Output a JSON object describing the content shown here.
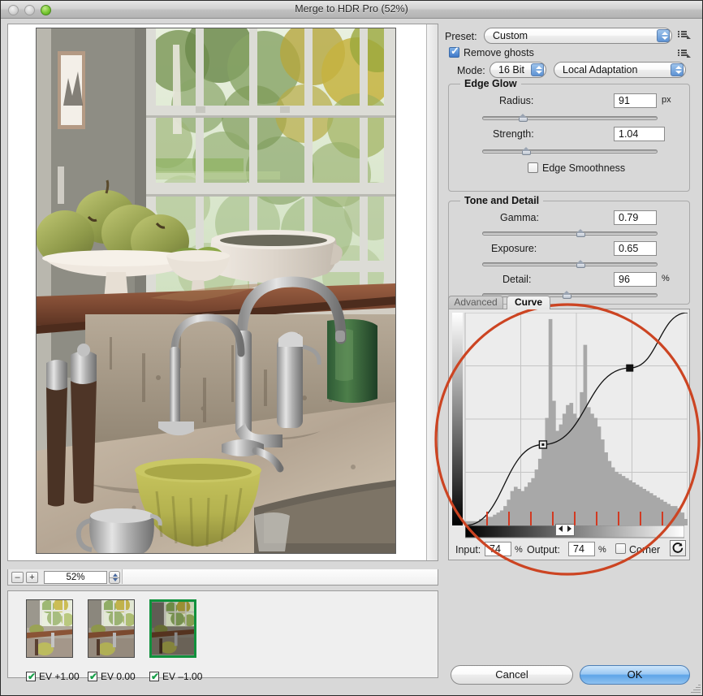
{
  "window": {
    "title": "Merge to HDR Pro (52%)",
    "traffic_lights": [
      "close",
      "minimize",
      "zoom"
    ]
  },
  "preview": {
    "zoom_value": "52%",
    "zoom_out_label": "–",
    "zoom_in_label": "+",
    "image_alt": "Kitchen counter with pears on a cake stand, white bowl, window with trees outside, faucet and green mixing bowl"
  },
  "thumbnails": [
    {
      "label": "EV +1.00",
      "checked": true,
      "selected": false
    },
    {
      "label": "EV 0.00",
      "checked": true,
      "selected": false
    },
    {
      "label": "EV –1.00",
      "checked": true,
      "selected": true
    }
  ],
  "settings": {
    "preset_label": "Preset:",
    "preset_value": "Custom",
    "remove_ghosts_label": "Remove ghosts",
    "remove_ghosts_checked": true,
    "mode_label": "Mode:",
    "bit_depth_value": "16 Bit",
    "method_value": "Local Adaptation",
    "edge_glow": {
      "title": "Edge Glow",
      "radius_label": "Radius:",
      "radius_value": "91",
      "radius_unit": "px",
      "radius_pct": 23,
      "strength_label": "Strength:",
      "strength_value": "1.04",
      "strength_pct": 25,
      "edge_smoothness_label": "Edge Smoothness",
      "edge_smoothness_checked": false
    },
    "tone_and_detail": {
      "title": "Tone and Detail",
      "gamma_label": "Gamma:",
      "gamma_value": "0.79",
      "gamma_pct": 56,
      "exposure_label": "Exposure:",
      "exposure_value": "0.65",
      "exposure_pct": 56,
      "detail_label": "Detail:",
      "detail_value": "96",
      "detail_unit": "%",
      "detail_pct": 48
    }
  },
  "curve_panel": {
    "tabs": [
      {
        "label": "Advanced",
        "active": false
      },
      {
        "label": "Curve",
        "active": true
      }
    ],
    "input_label": "Input:",
    "input_value": "74",
    "input_unit": "%",
    "output_label": "Output:",
    "output_value": "74",
    "output_unit": "%",
    "corner_label": "Corner",
    "corner_checked": false,
    "reset_icon": "reset-circular-arrow-icon",
    "annotation_color": "#cc4422"
  },
  "buttons": {
    "cancel_label": "Cancel",
    "ok_label": "OK"
  },
  "chart_data": {
    "type": "line",
    "title": "Tone Curve with Luminosity Histogram",
    "xlabel": "Input",
    "ylabel": "Output",
    "xlim": [
      0,
      100
    ],
    "ylim": [
      0,
      100
    ],
    "grid": true,
    "curve_points": [
      {
        "x": 0,
        "y": 0,
        "type": "endpoint"
      },
      {
        "x": 35,
        "y": 38,
        "type": "selected-control-point"
      },
      {
        "x": 74,
        "y": 74,
        "type": "control-point"
      },
      {
        "x": 100,
        "y": 100,
        "type": "endpoint"
      }
    ],
    "histogram": {
      "bins": 64,
      "values": [
        2,
        2,
        2,
        2,
        3,
        3,
        4,
        4,
        5,
        6,
        7,
        9,
        12,
        16,
        18,
        17,
        16,
        18,
        20,
        22,
        26,
        31,
        38,
        50,
        96,
        58,
        44,
        47,
        52,
        56,
        57,
        52,
        50,
        62,
        84,
        55,
        52,
        50,
        46,
        40,
        34,
        30,
        27,
        25,
        24,
        23,
        22,
        21,
        20,
        19,
        18,
        17,
        16,
        15,
        14,
        13,
        12,
        11,
        10,
        9,
        9,
        8,
        6,
        3
      ]
    }
  }
}
